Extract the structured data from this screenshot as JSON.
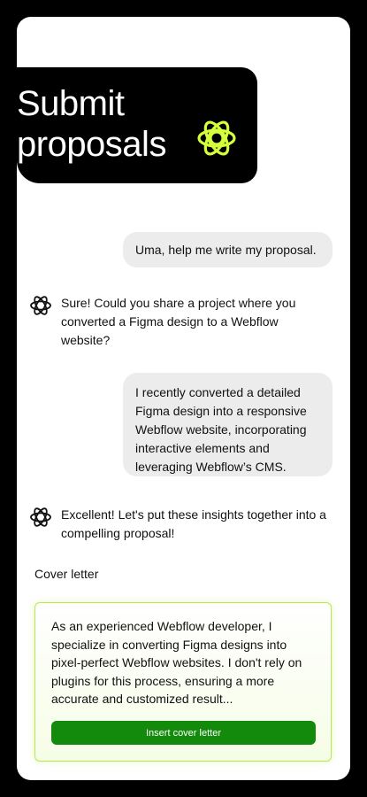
{
  "hero": {
    "title": "Submit\nproposals",
    "logo_icon": "flower-orbit-icon",
    "accent_color": "#d4ff3a"
  },
  "chat": {
    "messages": [
      {
        "role": "user",
        "text": "Uma, help me write my proposal."
      },
      {
        "role": "assistant",
        "icon": "atom-icon",
        "text": "Sure! Could you share a project where you converted a Figma design to a Webflow website?"
      },
      {
        "role": "user",
        "text": "I recently converted a detailed Figma design into a responsive Webflow website, incorporating interactive elements and leveraging Webflow’s CMS."
      },
      {
        "role": "assistant",
        "icon": "atom-icon",
        "text": "Excellent! Let's put these insights together into a compelling proposal!"
      }
    ]
  },
  "cover_letter": {
    "label": "Cover letter",
    "text": "As an experienced Webflow developer, I specialize in converting Figma designs into pixel-perfect Webflow websites. I don't rely on plugins for this process, ensuring a more accurate and customized result...",
    "button_label": "Insert cover letter",
    "button_color": "#138a0b",
    "border_color": "#b5ea4b"
  }
}
